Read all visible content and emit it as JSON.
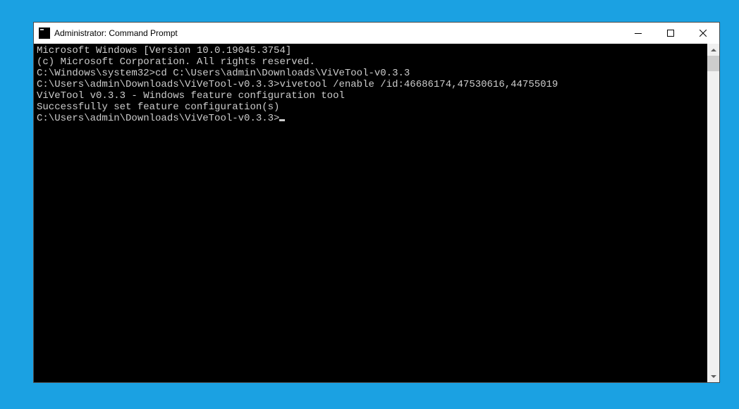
{
  "window": {
    "title": "Administrator: Command Prompt"
  },
  "console": {
    "line1": "Microsoft Windows [Version 10.0.19045.3754]",
    "line2": "(c) Microsoft Corporation. All rights reserved.",
    "blank1": "",
    "prompt1": "C:\\Windows\\system32>",
    "cmd1": "cd C:\\Users\\admin\\Downloads\\ViVeTool-v0.3.3",
    "blank2": "",
    "prompt2": "C:\\Users\\admin\\Downloads\\ViVeTool-v0.3.3>",
    "cmd2": "vivetool /enable /id:46686174,47530616,44755019",
    "line3": "ViVeTool v0.3.3 - Windows feature configuration tool",
    "blank3": "",
    "line4": "Successfully set feature configuration(s)",
    "blank4": "",
    "prompt3": "C:\\Users\\admin\\Downloads\\ViVeTool-v0.3.3>"
  }
}
